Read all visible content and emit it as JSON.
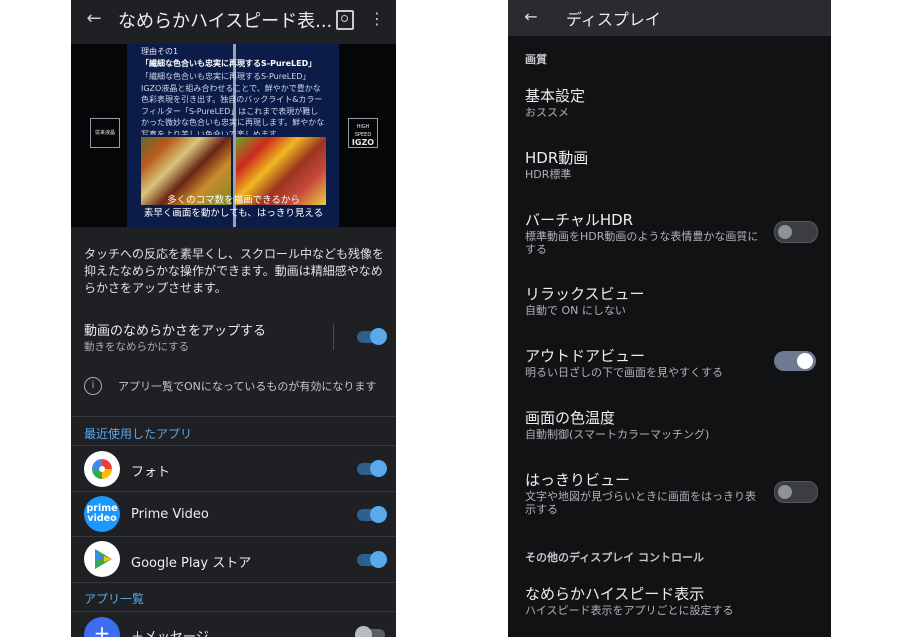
{
  "left": {
    "header": {
      "back_icon": "arrow-left-icon",
      "title": "なめらかハイスピード表...",
      "search_icon": "page-search-icon",
      "more_icon": "more-vert-icon"
    },
    "promo": {
      "reason": "理由その1",
      "heading": "「繊細な色合いも忠実に再現するS-PureLED」",
      "body": "「繊細な色合いも忠実に再現するS-PureLED」 IGZO液晶と組み合わせることで、鮮やかで豊かな色彩表現を引き出す。独自のバックライト&カラーフィルター「S-PureLED」はこれまで表現が難しかった微妙な色合いも忠実に再現します。鮮やかな写真をより美しい色合いで楽しめます。",
      "caption_line1": "多くのコマ数を描画できるから",
      "caption_line2": "素早く画面を動かしても、はっきり見える",
      "badge_left": "従来液晶",
      "badge_right_top": "HIGH SPEED",
      "badge_right_main": "IGZO"
    },
    "description": "タッチへの反応を素早くし、スクロール中なども残像を抑えたなめらかな操作ができます。動画は精細感やなめらかさをアップさせます。",
    "main_toggle": {
      "label": "動画のなめらかさをアップする",
      "sub": "動きをなめらかにする",
      "state": "on"
    },
    "info": {
      "icon": "info-icon",
      "text": "アプリ一覧でONになっているものが有効になります"
    },
    "recent_section": "最近使用したアプリ",
    "apps": [
      {
        "name": "フォト",
        "icon": "google-photos-icon",
        "state": "on"
      },
      {
        "name": "Prime Video",
        "icon": "prime-video-icon",
        "icon_text_1": "prime",
        "icon_text_2": "video",
        "state": "on"
      },
      {
        "name": "Google Play ストア",
        "icon": "google-play-icon",
        "state": "on"
      }
    ],
    "all_section": "アプリ一覧",
    "partial_app": {
      "name": "＋メッセージ",
      "icon": "plus-message-icon",
      "icon_glyph": "+",
      "state": "off"
    }
  },
  "right": {
    "header": {
      "back_icon": "arrow-left-icon",
      "title": "ディスプレイ"
    },
    "section_quality": "画質",
    "items": [
      {
        "title": "基本設定",
        "sub": "おススメ"
      },
      {
        "title": "HDR動画",
        "sub": "HDR標準"
      },
      {
        "title": "バーチャルHDR",
        "sub": "標準動画をHDR動画のような表情豊かな画質にする",
        "toggle": "off"
      },
      {
        "title": "リラックスビュー",
        "sub": "自動で ON にしない"
      },
      {
        "title": "アウトドアビュー",
        "sub": "明るい日ざしの下で画面を見やすくする",
        "toggle": "on"
      },
      {
        "title": "画面の色温度",
        "sub": "自動制御(スマートカラーマッチング)"
      },
      {
        "title": "はっきりビュー",
        "sub": "文字や地図が見づらいときに画面をはっきり表示する",
        "toggle": "off"
      }
    ],
    "section_other": "その他のディスプレイ コントロール",
    "last_item": {
      "title": "なめらかハイスピード表示",
      "sub": "ハイスピード表示をアプリごとに設定する"
    }
  },
  "colors": {
    "accent": "#5aa9ea",
    "left_bg": "#1e2024",
    "right_bg": "#111214"
  }
}
